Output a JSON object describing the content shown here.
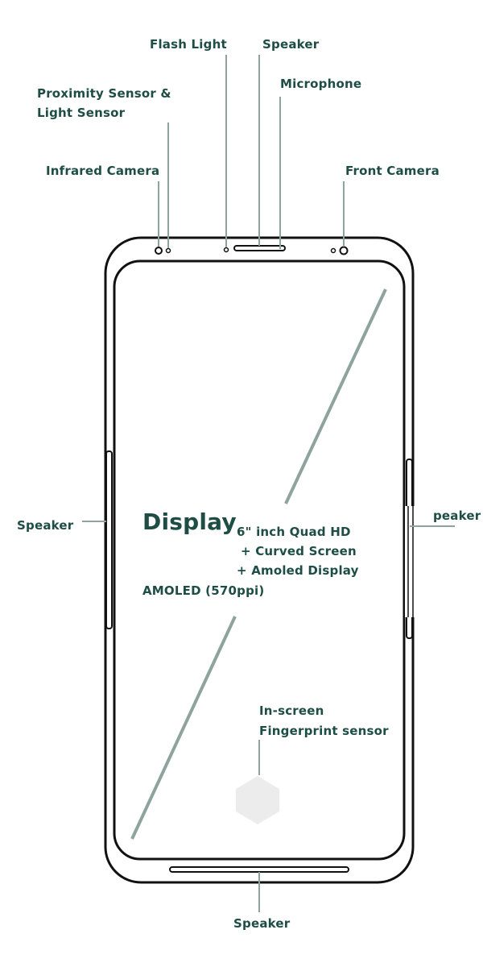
{
  "colors": {
    "text": "#1d4d45",
    "leader": "#8fa39e",
    "outline": "#111111",
    "sensor_fill": "#ececec"
  },
  "labels": {
    "flash_light": "Flash Light",
    "speaker_top": "Speaker",
    "microphone": "Microphone",
    "proximity_sensor": "Proximity Sensor &",
    "light_sensor": "Light Sensor",
    "infrared_camera": "Infrared Camera",
    "front_camera": "Front Camera",
    "speaker_left": "Speaker",
    "speaker_right": "peaker",
    "speaker_bottom": "Speaker",
    "fingerprint_line1": "In-screen",
    "fingerprint_line2": "Fingerprint sensor"
  },
  "display": {
    "title": "Display",
    "spec_line1": "6\" inch Quad HD",
    "spec_line2": "+ Curved Screen",
    "spec_line3": "+ Amoled Display",
    "spec_line4": "AMOLED (570ppi)"
  }
}
